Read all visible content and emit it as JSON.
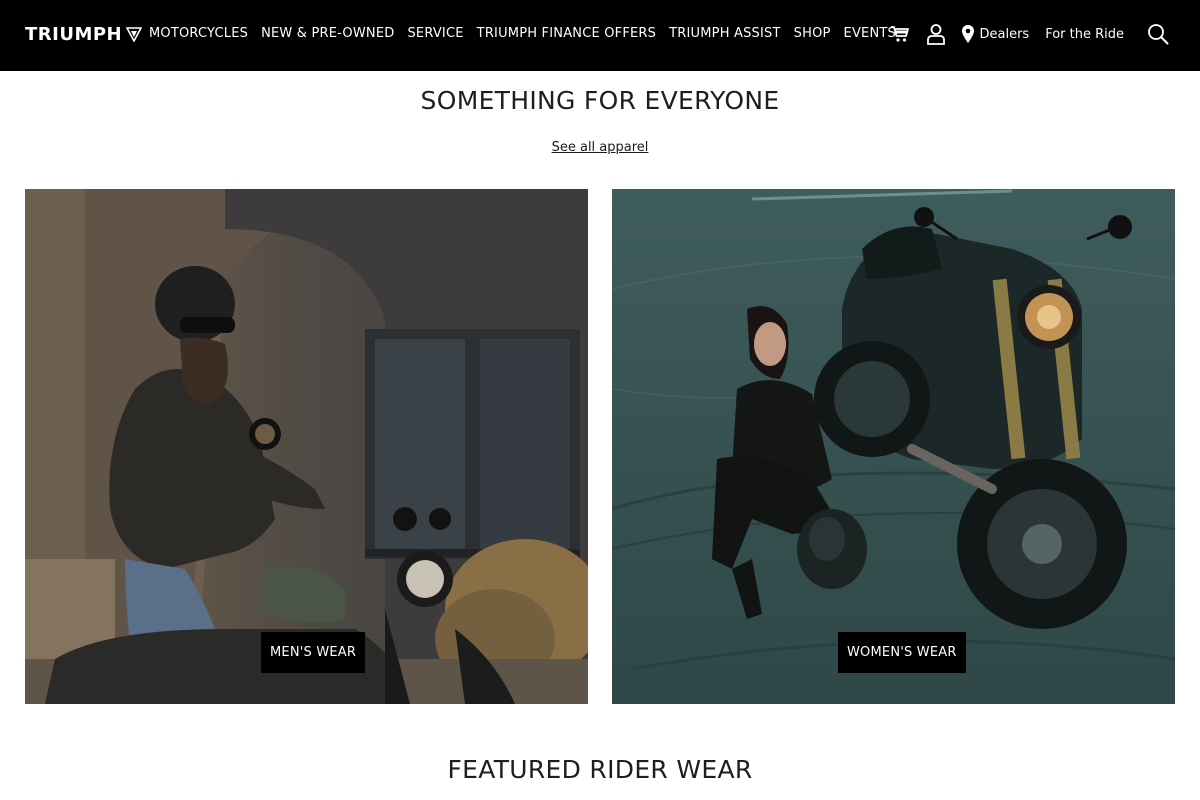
{
  "nav": {
    "logo_text": "TRIUMPH",
    "links": [
      "MOTORCYCLES",
      "NEW & PRE-OWNED",
      "SERVICE",
      "TRIUMPH FINANCE OFFERS",
      "TRIUMPH ASSIST",
      "SHOP",
      "EVENTS"
    ],
    "dealers_label": "Dealers",
    "for_the_ride_label": "For the Ride",
    "icons": {
      "cart": "cart-icon",
      "account": "user-icon",
      "dealers": "map-pin-icon",
      "search": "search-icon"
    }
  },
  "main": {
    "title": "SOMETHING FOR EVERYONE",
    "see_all_label": "See all apparel",
    "tiles": [
      {
        "label": "MEN'S WEAR"
      },
      {
        "label": "WOMEN'S WEAR"
      }
    ],
    "featured_title": "FEATURED RIDER WEAR"
  },
  "colors": {
    "nav_bg": "#000000",
    "label_bg": "#000000",
    "text": "#1e1e1e"
  }
}
